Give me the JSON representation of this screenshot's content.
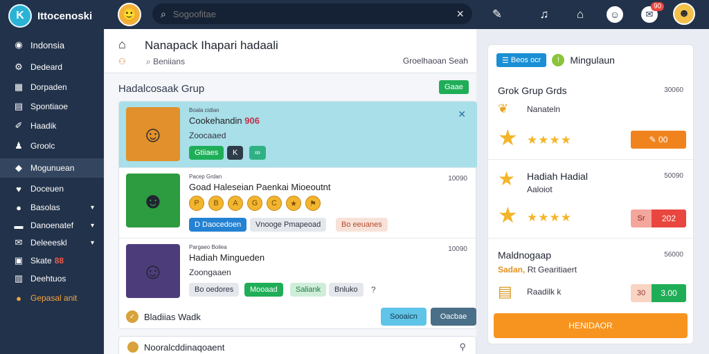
{
  "app": {
    "name": "Ittocenoski",
    "logo_letter": "K"
  },
  "search": {
    "placeholder": "Sogoofitae",
    "value": ""
  },
  "header_icons": [
    "pencil-icon",
    "bell-icon",
    "bookmark-icon",
    "smile-icon",
    "chat-icon"
  ],
  "notifications": {
    "count": "90"
  },
  "sidebar": {
    "items": [
      {
        "label": "Indonsia",
        "icon": "globe-icon"
      },
      {
        "label": "Dedeard",
        "icon": "gear-icon"
      },
      {
        "label": "Dorpaden",
        "icon": "grid-icon"
      },
      {
        "label": "Spontiaoe",
        "icon": "book-icon"
      },
      {
        "label": "Haadik",
        "icon": "pin-icon"
      },
      {
        "label": "Groolc",
        "icon": "user-icon"
      },
      {
        "label": "Mogunuean",
        "icon": "game-icon"
      },
      {
        "label": "Doceuen",
        "icon": "heart-icon"
      },
      {
        "label": "Basolas",
        "icon": "circle-icon"
      },
      {
        "label": "Danoenatef",
        "icon": "list-icon"
      },
      {
        "label": "Deleeeskl",
        "icon": "mail-icon"
      },
      {
        "label": "Skate",
        "icon": "chart-icon",
        "badge": "88"
      },
      {
        "label": "Deehtuos",
        "icon": "doc-icon"
      },
      {
        "label": "Gepasal anit",
        "icon": "fire-icon"
      }
    ]
  },
  "page": {
    "title": "Nanapack Ihapari hadaali",
    "subtitle": "Beniians",
    "note": "Groelhaoan Seah"
  },
  "section": {
    "title": "Hadalcosaak Grup",
    "button": "Gaae"
  },
  "cards": [
    {
      "meta": "Boala cidian",
      "title": "Cookehandin",
      "title_number": "906",
      "subtitle": "Zoocaaed",
      "tags": [
        "Gtiiaes",
        "K",
        "∞"
      ]
    },
    {
      "meta": "Pacep Grdan",
      "title": "Goad Haleseian Paenkai Mioeoutnt",
      "number": "10090",
      "coins": [
        "P",
        "B",
        "A",
        "G",
        "C",
        "★",
        "⚑"
      ],
      "tags": [
        "D Daocedoen",
        "Vnooge Pmapeoad",
        "Bo eeuanes"
      ]
    },
    {
      "meta": "Pargaeo Boilea",
      "title": "Hadiah Mingueden",
      "number": "10090",
      "subtitle": "Zoongaaen",
      "tags": [
        "Bo oedores",
        "Mooaad",
        "Saliank",
        "Bnluko"
      ]
    }
  ],
  "card_footer": {
    "label": "Bladiias Wadk",
    "btn_primary": "Sooaicn",
    "btn_secondary": "Oacbae"
  },
  "bottom_card": {
    "label": "Nooralcddinaqoaent",
    "icon_right": "link-icon"
  },
  "right_panel": {
    "chip": "Beos ocr",
    "label": "Mingulaun",
    "rewards": [
      {
        "title": "Grok Grup Grds",
        "number": "30060",
        "sub": "Nanateln",
        "rating": 4,
        "button": "00"
      },
      {
        "title": "Hadiah Hadial",
        "number": "50090",
        "sub": "Aaloiot",
        "rating": 4,
        "btn_a": "Sr",
        "btn_b": "202"
      },
      {
        "title": "Maldnogaap",
        "number": "56000",
        "small_prefix": "Sadan,",
        "small_text": "Rt Gearitiaert",
        "label": "Raadilk k",
        "btn_a": "30",
        "btn_b": "3.00"
      }
    ],
    "claim_button": "HENIDAOR"
  },
  "colors": {
    "topbar": "#22324a",
    "accent_green": "#1fae57",
    "accent_orange": "#f7941f",
    "highlight": "#a8dfe8"
  }
}
